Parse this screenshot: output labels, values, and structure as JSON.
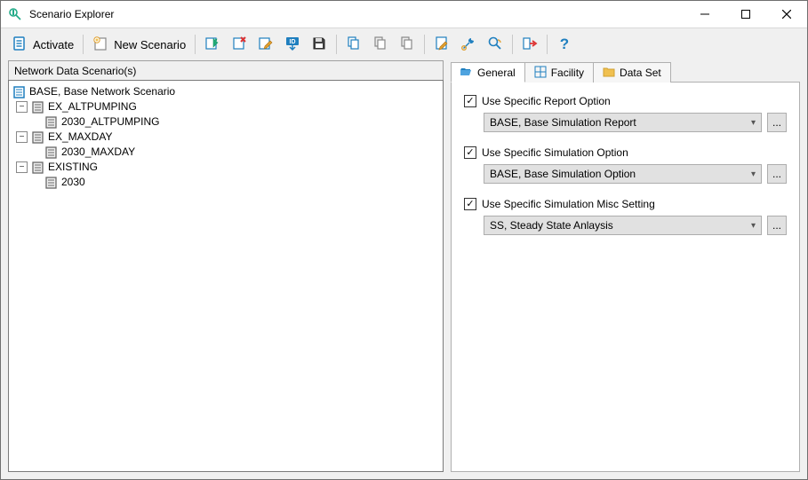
{
  "window": {
    "title": "Scenario Explorer"
  },
  "toolbar": {
    "activate_label": "Activate",
    "new_scenario_label": "New Scenario"
  },
  "left": {
    "header": "Network Data Scenario(s)",
    "tree": {
      "root": "BASE, Base Network Scenario",
      "n1": "EX_ALTPUMPING",
      "n1a": "2030_ALTPUMPING",
      "n2": "EX_MAXDAY",
      "n2a": "2030_MAXDAY",
      "n3": "EXISTING",
      "n3a": "2030"
    }
  },
  "tabs": {
    "general": "General",
    "facility": "Facility",
    "dataset": "Data Set"
  },
  "general": {
    "use_report": "Use Specific Report Option",
    "report_value": "BASE, Base Simulation Report",
    "use_sim": "Use Specific Simulation Option",
    "sim_value": "BASE, Base Simulation Option",
    "use_misc": "Use Specific Simulation Misc Setting",
    "misc_value": "SS, Steady State Anlaysis",
    "dots": "..."
  }
}
